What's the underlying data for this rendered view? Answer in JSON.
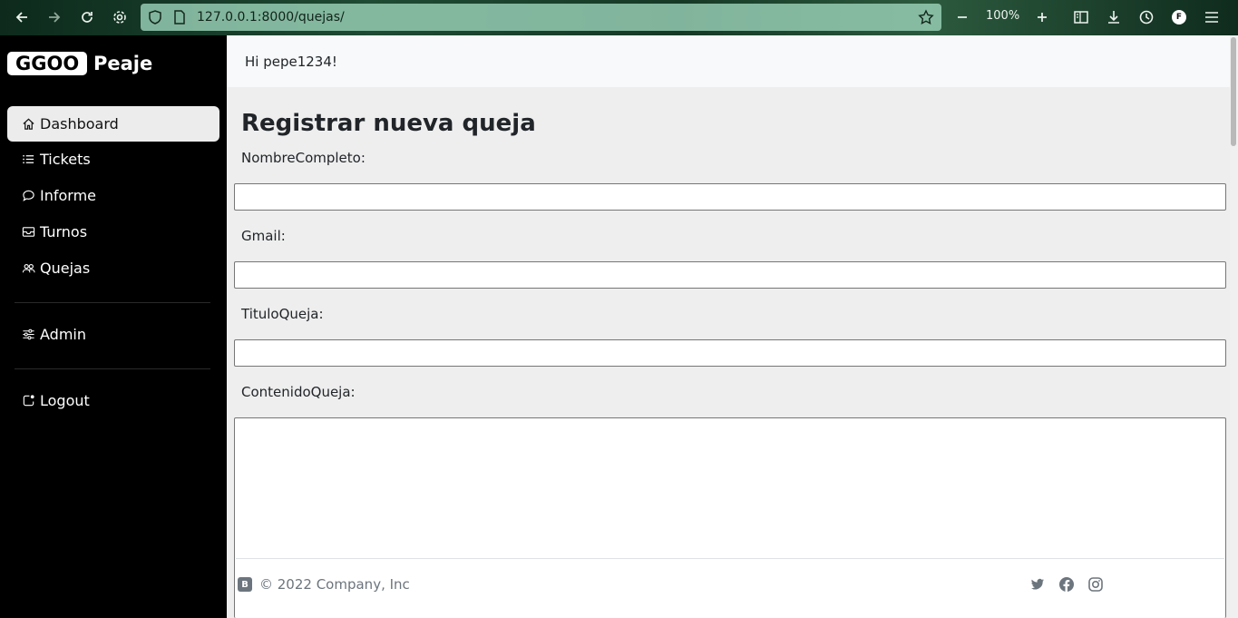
{
  "browser": {
    "url": "127.0.0.1:8000/quejas/",
    "zoom": "100%",
    "profile_initial": "F"
  },
  "sidebar": {
    "brand_box": "GGOO",
    "brand_text": "Peaje",
    "items": [
      {
        "label": "Dashboard",
        "icon": "house-icon",
        "active": true
      },
      {
        "label": "Tickets",
        "icon": "list-icon",
        "active": false
      },
      {
        "label": "Informe",
        "icon": "chat-icon",
        "active": false
      },
      {
        "label": "Turnos",
        "icon": "envelope-icon",
        "active": false
      },
      {
        "label": "Quejas",
        "icon": "people-icon",
        "active": false
      },
      {
        "label": "Admin",
        "icon": "sliders-icon",
        "active": false
      },
      {
        "label": "Logout",
        "icon": "power-icon",
        "active": false
      }
    ]
  },
  "header": {
    "greeting": "Hi pepe1234!"
  },
  "form": {
    "title": "Registrar nueva queja",
    "fields": [
      {
        "label": "NombreCompleto:",
        "value": ""
      },
      {
        "label": "Gmail:",
        "value": ""
      },
      {
        "label": "TituloQueja:",
        "value": ""
      },
      {
        "label": "ContenidoQueja:",
        "value": ""
      }
    ]
  },
  "footer": {
    "badge": "B",
    "copyright": "© 2022 Company, Inc",
    "social": [
      "twitter-icon",
      "facebook-icon",
      "instagram-icon"
    ]
  },
  "colors": {
    "sidebar_bg": "#000000",
    "active_item_bg": "#ececec",
    "main_bg": "#eeeeee",
    "topbar_bg": "#f8f9fa",
    "url_bar_bg": "#a0d7be"
  }
}
